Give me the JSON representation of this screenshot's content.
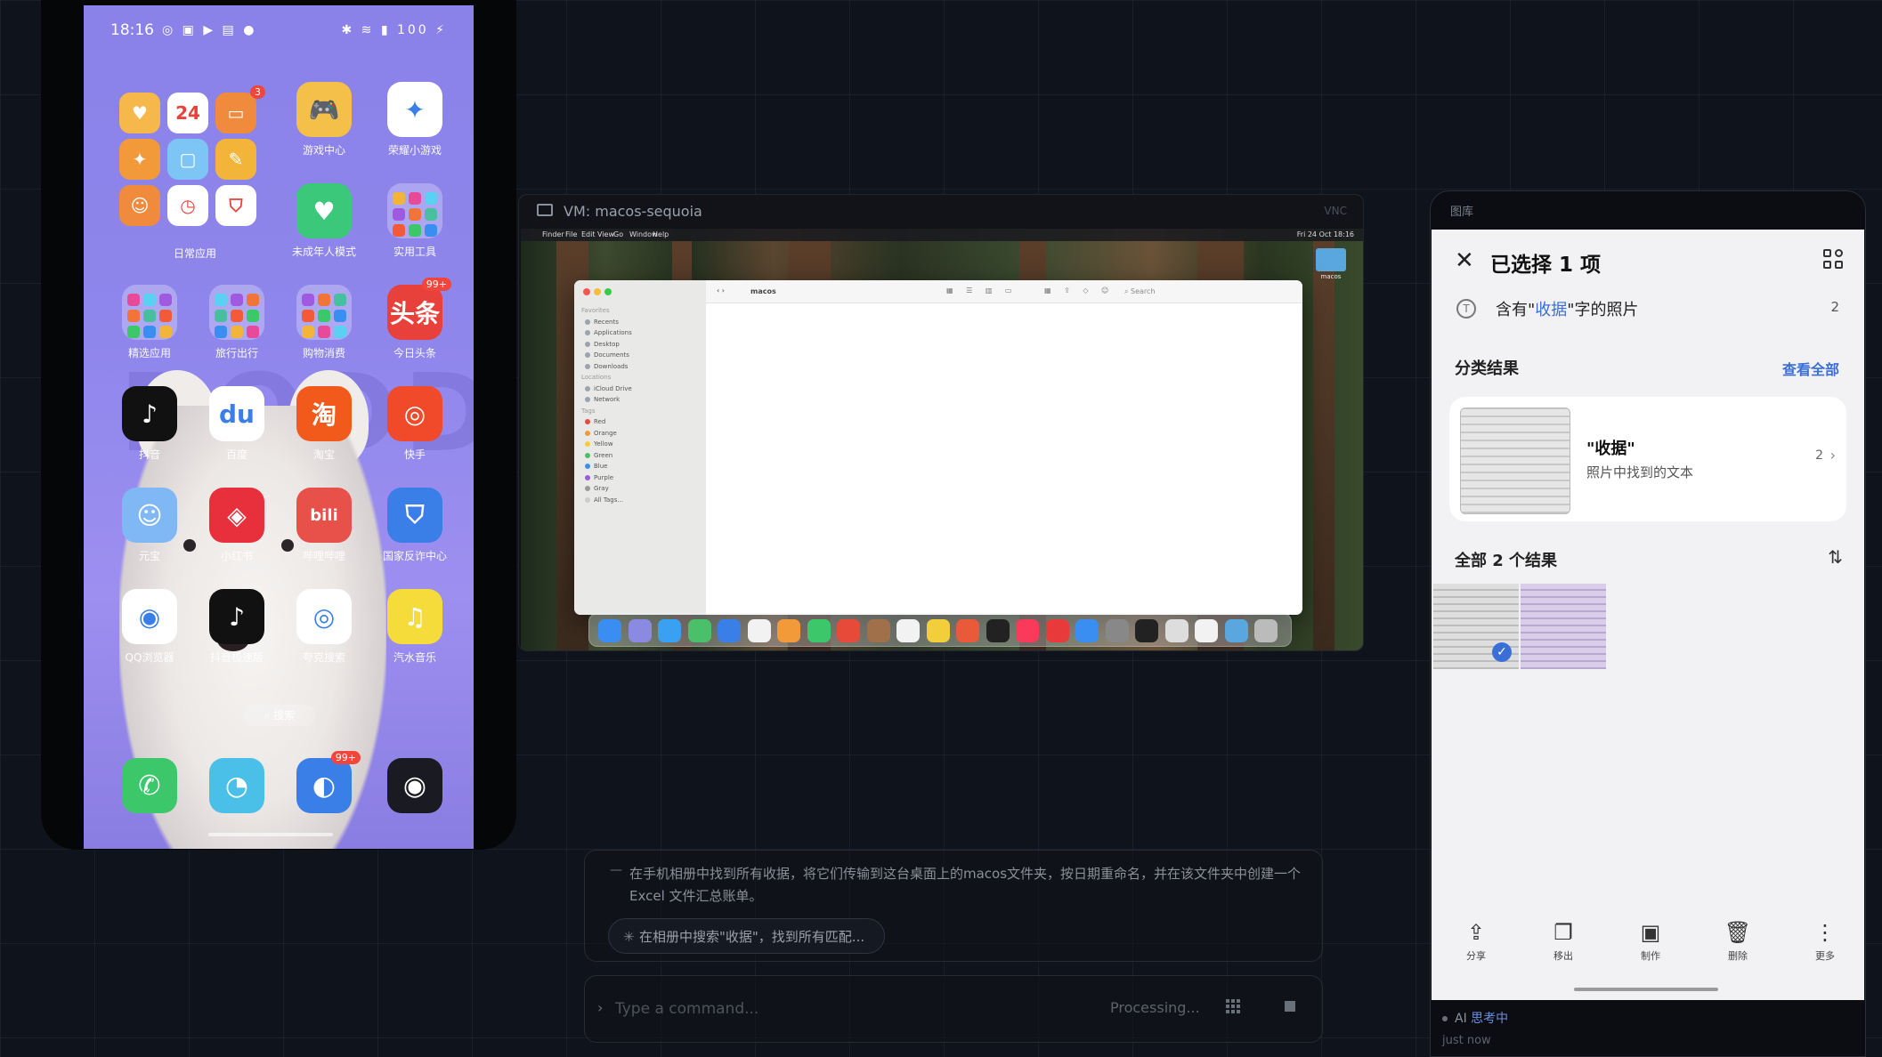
{
  "left_phone": {
    "status_time": "18:16",
    "status_icons_left": "◎ ▣ ▶ ▤ ●",
    "status_icons_right": "✱ ≋ ▮ 100 ⚡",
    "bg_text": "DODDY",
    "mini_apps": [
      {
        "name": "mini-heart-app",
        "glyph": "♥",
        "color": "#f6b84a"
      },
      {
        "name": "mini-calendar-app",
        "glyph": "24",
        "color": "#ffffff"
      },
      {
        "name": "mini-wallet-app",
        "glyph": "▭",
        "color": "#f08a3c"
      },
      {
        "name": "mini-pin-app",
        "glyph": "✦",
        "color": "#f29a3a"
      },
      {
        "name": "mini-screen-app",
        "glyph": "▢",
        "color": "#7cc5f5"
      },
      {
        "name": "mini-pen-app",
        "glyph": "✎",
        "color": "#f3b43a"
      },
      {
        "name": "mini-taobao-cat-app",
        "glyph": "☺",
        "color": "#f08a3c"
      },
      {
        "name": "mini-clock-app",
        "glyph": "◷",
        "color": "#ffffff"
      },
      {
        "name": "mini-shield-app",
        "glyph": "⛉",
        "color": "#ffffff"
      }
    ],
    "mini_badge": "3",
    "folder_label": "日常应用",
    "apps": [
      {
        "name": "game-center-app",
        "label": "游戏中心",
        "glyph": "🎮",
        "color": "#f5c04a",
        "badge": ""
      },
      {
        "name": "mini-games-app",
        "label": "荣耀小游戏",
        "glyph": "✦",
        "color": "#ffffff",
        "badge": ""
      },
      {
        "name": "teen-mode-app",
        "label": "未成年人模式",
        "glyph": "♥",
        "color": "#3cc87a",
        "badge": ""
      },
      {
        "name": "tools-folder",
        "label": "实用工具",
        "glyph": "",
        "color": "",
        "badge": ""
      },
      {
        "name": "recommend-folder",
        "label": "精选应用",
        "glyph": "",
        "color": "",
        "badge": ""
      },
      {
        "name": "travel-folder",
        "label": "旅行出行",
        "glyph": "",
        "color": "",
        "badge": ""
      },
      {
        "name": "shopping-folder",
        "label": "购物消费",
        "glyph": "",
        "color": "",
        "badge": ""
      },
      {
        "name": "toutiao-app",
        "label": "今日头条",
        "glyph": "头条",
        "color": "#e8403a",
        "badge": "99+"
      },
      {
        "name": "douyin-app",
        "label": "抖音",
        "glyph": "♪",
        "color": "#111111",
        "badge": ""
      },
      {
        "name": "baidu-app",
        "label": "百度",
        "glyph": "du",
        "color": "#ffffff",
        "badge": ""
      },
      {
        "name": "taobao-app",
        "label": "淘宝",
        "glyph": "淘",
        "color": "#f25a1c",
        "badge": ""
      },
      {
        "name": "kuaishou-app",
        "label": "快手",
        "glyph": "◎",
        "color": "#f04a2a",
        "badge": ""
      },
      {
        "name": "yuanbao-app",
        "label": "元宝",
        "glyph": "☺",
        "color": "#7fb8f5",
        "badge": ""
      },
      {
        "name": "xiaohongshu-app",
        "label": "小红书",
        "glyph": "◈",
        "color": "#e8303c",
        "badge": ""
      },
      {
        "name": "bilibili-app",
        "label": "哔哩哔哩",
        "glyph": "bili",
        "color": "#e8504a",
        "badge": ""
      },
      {
        "name": "anti-fraud-app",
        "label": "国家反诈中心",
        "glyph": "⛉",
        "color": "#3a7ee8",
        "badge": ""
      },
      {
        "name": "qq-browser-app",
        "label": "QQ浏览器",
        "glyph": "◉",
        "color": "#ffffff",
        "badge": ""
      },
      {
        "name": "douyin-lite-app",
        "label": "抖音极速版",
        "glyph": "♪",
        "color": "#111111",
        "badge": ""
      },
      {
        "name": "search-app",
        "label": "夸克搜索",
        "glyph": "◎",
        "color": "#ffffff",
        "badge": ""
      },
      {
        "name": "music-app",
        "label": "汽水音乐",
        "glyph": "♫",
        "color": "#f5dc3a",
        "badge": ""
      }
    ],
    "search_label": "搜索",
    "dock": [
      {
        "name": "phone-app",
        "glyph": "✆",
        "color": "#3cc86a",
        "badge": ""
      },
      {
        "name": "messages-app",
        "glyph": "◔",
        "color": "#4ac0e8",
        "badge": ""
      },
      {
        "name": "browser-app",
        "glyph": "◐",
        "color": "#3a7ee8",
        "badge": "99+"
      },
      {
        "name": "camera-app",
        "glyph": "◉",
        "color": "#1a1a22",
        "badge": ""
      }
    ]
  },
  "vm": {
    "title": "VM: macos-sequoia",
    "vnc_label": "VNC",
    "menubar_items": [
      "",
      "Finder",
      "File",
      "Edit",
      "View",
      "Go",
      "Window",
      "Help"
    ],
    "menubar_right": "Fri 24 Oct 18:16",
    "finder_path": "macos",
    "finder_search": "Search",
    "desk_folder_label": "macos",
    "sidebar": [
      {
        "label": "Favorites",
        "dot": ""
      },
      {
        "label": "Recents",
        "dot": "#9aa3b0"
      },
      {
        "label": "Applications",
        "dot": "#9aa3b0"
      },
      {
        "label": "Desktop",
        "dot": "#9aa3b0"
      },
      {
        "label": "Documents",
        "dot": "#9aa3b0"
      },
      {
        "label": "Downloads",
        "dot": "#9aa3b0"
      },
      {
        "label": "Locations",
        "dot": ""
      },
      {
        "label": "iCloud Drive",
        "dot": "#9aa3b0"
      },
      {
        "label": "Network",
        "dot": "#9aa3b0"
      },
      {
        "label": "Tags",
        "dot": ""
      },
      {
        "label": "Red",
        "dot": "#e84a3a"
      },
      {
        "label": "Orange",
        "dot": "#f29a3a"
      },
      {
        "label": "Yellow",
        "dot": "#f2cf3a"
      },
      {
        "label": "Green",
        "dot": "#4ac06a"
      },
      {
        "label": "Blue",
        "dot": "#3a8ef2"
      },
      {
        "label": "Purple",
        "dot": "#9a5ae0"
      },
      {
        "label": "Gray",
        "dot": "#9a9a9a"
      },
      {
        "label": "All Tags...",
        "dot": "#cccccc"
      }
    ],
    "dock_colors": [
      "#3a8ef2",
      "#8a8ae0",
      "#3aa0f2",
      "#4ac06a",
      "#3a7ee8",
      "#f2f2f2",
      "#f29a3a",
      "#3cc86a",
      "#e84a3a",
      "#a0704a",
      "#f2f2f2",
      "#f2cf3a",
      "#e85a3a",
      "#222222",
      "#fa3a5a",
      "#e83a3a",
      "#3a8ef2",
      "#888888",
      "#222222",
      "#dddddd",
      "#f2f2f2",
      "#5aa7e0",
      "#bbbbbb"
    ]
  },
  "chat": {
    "message": "在手机相册中找到所有收据，将它们传输到这台桌面上的macos文件夹，按日期重命名，并在该文件夹中创建一个 Excel 文件汇总账单。",
    "step": "在相册中搜索\"收据\"，找到所有匹配...",
    "command_placeholder": "Type a command...",
    "status": "Processing..."
  },
  "gallery": {
    "window_title": "图库",
    "title": "已选择 1 项",
    "query_prefix": "含有\"",
    "query_keyword": "收据",
    "query_suffix": "\"字的照片",
    "query_count": "2",
    "section_classified": "分类结果",
    "view_all": "查看全部",
    "card_name": "\"收据\"",
    "card_sub": "照片中找到的文本",
    "card_count": "2",
    "section_all": "全部 2 个结果",
    "actions": [
      {
        "name": "share-action",
        "icon": "⇪",
        "label": "分享"
      },
      {
        "name": "copy-action",
        "icon": "❐",
        "label": "移出"
      },
      {
        "name": "create-action",
        "icon": "▣",
        "label": "制作"
      },
      {
        "name": "delete-action",
        "icon": "🗑",
        "label": "删除"
      },
      {
        "name": "more-action",
        "icon": "⋮",
        "label": "更多"
      }
    ]
  },
  "agent_status": {
    "prefix": "AI",
    "label": "思考中",
    "sub": "just now"
  }
}
